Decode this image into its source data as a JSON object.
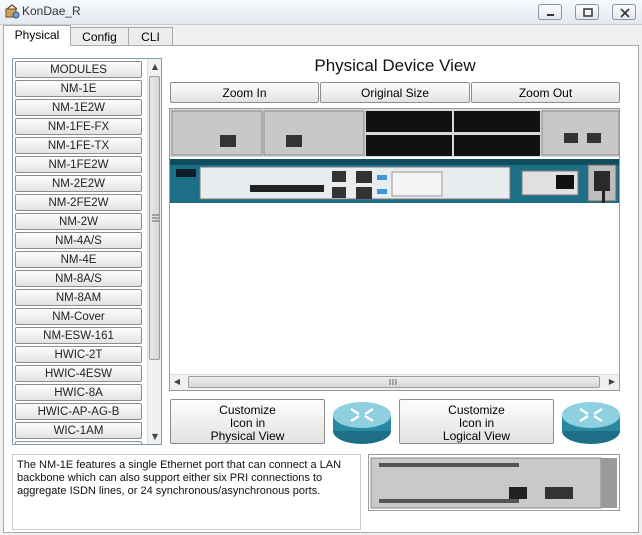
{
  "window": {
    "title": "KonDae_R"
  },
  "tabs": [
    {
      "label": "Physical"
    },
    {
      "label": "Config"
    },
    {
      "label": "CLI"
    }
  ],
  "modules": {
    "items": [
      "MODULES",
      "NM-1E",
      "NM-1E2W",
      "NM-1FE-FX",
      "NM-1FE-TX",
      "NM-1FE2W",
      "NM-2E2W",
      "NM-2FE2W",
      "NM-2W",
      "NM-4A/S",
      "NM-4E",
      "NM-8A/S",
      "NM-8AM",
      "NM-Cover",
      "NM-ESW-161",
      "HWIC-2T",
      "HWIC-4ESW",
      "HWIC-8A",
      "HWIC-AP-AG-B",
      "WIC-1AM"
    ]
  },
  "physical": {
    "title": "Physical Device View",
    "zoom_in": "Zoom In",
    "original_size": "Original Size",
    "zoom_out": "Zoom Out"
  },
  "customize": {
    "physical": [
      "Customize",
      "Icon in",
      "Physical View"
    ],
    "logical": [
      "Customize",
      "Icon in",
      "Logical View"
    ]
  },
  "description": "The NM-1E features a single Ethernet port that can connect a LAN backbone which can also support either six PRI connections to aggregate ISDN lines, or 24 synchronous/asynchronous ports.",
  "colors": {
    "router_teal": "#1c6f86",
    "rack_black": "#111111",
    "link_blue": "#3a9ad9"
  }
}
